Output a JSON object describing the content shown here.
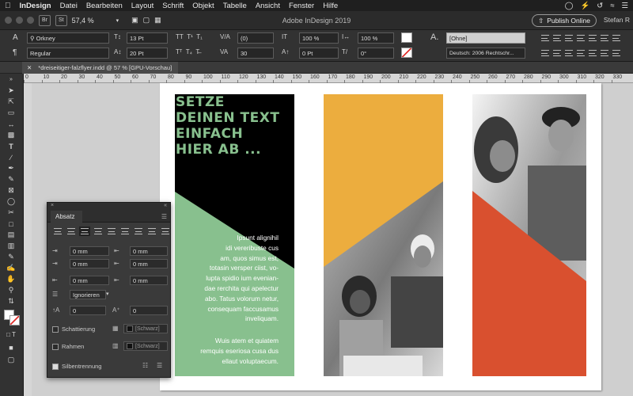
{
  "menubar": {
    "apple": "",
    "app": "InDesign",
    "items": [
      "Datei",
      "Bearbeiten",
      "Layout",
      "Schrift",
      "Objekt",
      "Tabelle",
      "Ansicht",
      "Fenster",
      "Hilfe"
    ]
  },
  "appbar": {
    "br_label": "Br",
    "st_label": "St",
    "zoom": "57,4 %",
    "title": "Adobe InDesign 2019",
    "publish": "Publish Online",
    "user": "Stefan R"
  },
  "control": {
    "font_name": "Orkney",
    "font_style": "Regular",
    "font_size": "13 Pt",
    "leading": "20 Pt",
    "kerning": "(0)",
    "tracking": "30",
    "scale_v": "100 %",
    "scale_h": "100 %",
    "baseline": "0 Pt",
    "skew": "0°",
    "para_style": "[Ohne]",
    "language": "Deutsch: 2006 Rechtschr..."
  },
  "document": {
    "tab_title": "*dreiseitiger-falzflyer.indd @ 57 % [GPU-Vorschau]"
  },
  "ruler": [
    "0",
    "10",
    "20",
    "30",
    "40",
    "50",
    "60",
    "70",
    "80",
    "90",
    "100",
    "110",
    "120",
    "130",
    "140",
    "150",
    "160",
    "170",
    "180",
    "190",
    "200",
    "210",
    "220",
    "230",
    "240",
    "250",
    "260",
    "270",
    "280",
    "290",
    "300",
    "310",
    "320",
    "330"
  ],
  "flyer": {
    "headline": [
      "SETZE",
      "DEINEN TEXT",
      "EINFACH",
      "HIER AB ..."
    ],
    "body1": [
      "Ipsunt alignihil",
      "idi vereribuste cus",
      "am, quos simus est,",
      "totasin versper ciist, vo-",
      "lupta spidio ium evenian-",
      "dae rerchita qui apelectur",
      "abo. Tatus volorum netur,",
      "consequam faccusamus",
      "inveliquam."
    ],
    "body2": [
      "Wuis atem et quiatem",
      "remquis eseriosa cusa dus",
      "ellaut voluptaecum."
    ],
    "colors": {
      "green": "#88c08e",
      "black": "#000000",
      "orange": "#ecad3e",
      "red": "#d9502f"
    }
  },
  "absatz_panel": {
    "title": "Absatz",
    "indent_left": "0 mm",
    "indent_right": "0 mm",
    "first_line": "0 mm",
    "last_line": "0 mm",
    "space_before": "0 mm",
    "space_after": "0 mm",
    "align_grid": "Ignorieren",
    "drop_lines": "0",
    "drop_chars": "0",
    "shading_label": "Schattierung",
    "shading_swatch": "[Schwarz]",
    "border_label": "Rahmen",
    "border_swatch": "[Schwarz]",
    "hyphen_label": "Silbentrennung"
  },
  "tools": [
    "selection-icon",
    "direct-selection-icon",
    "page-icon",
    "gap-icon",
    "content-collector-icon",
    "type-icon",
    "line-icon",
    "pen-icon",
    "pencil-icon",
    "rectangle-frame-icon",
    "rectangle-icon",
    "scissors-icon",
    "free-transform-icon",
    "gradient-icon",
    "note-icon",
    "eyedropper-icon",
    "hand-icon",
    "zoom-icon"
  ]
}
